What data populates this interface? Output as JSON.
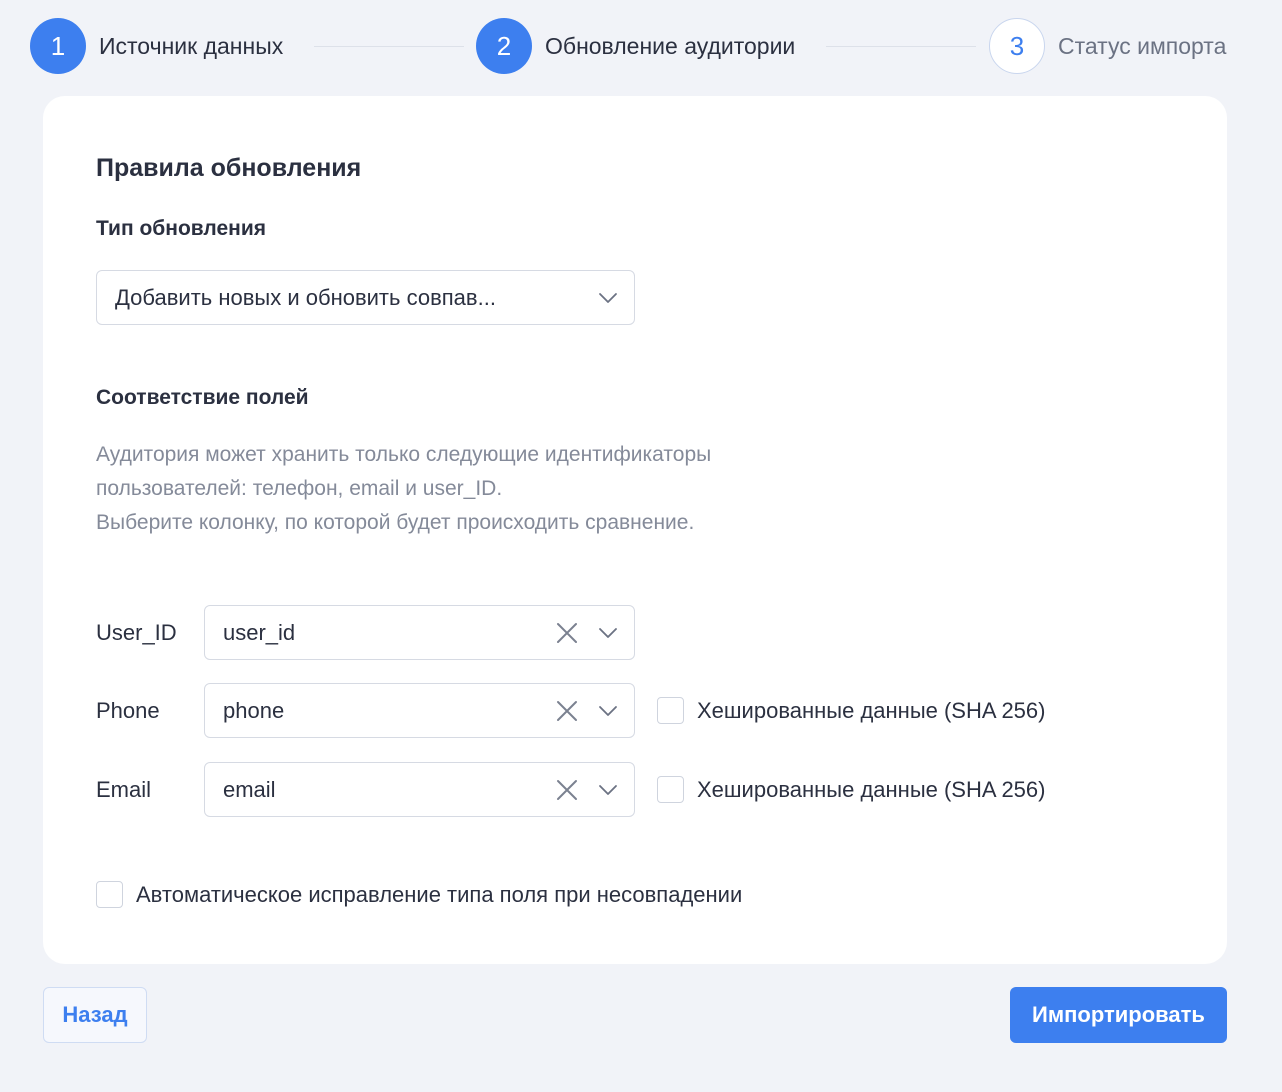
{
  "stepper": {
    "steps": [
      {
        "number": "1",
        "label": "Источник данных",
        "state": "active"
      },
      {
        "number": "2",
        "label": "Обновление аудитории",
        "state": "active"
      },
      {
        "number": "3",
        "label": "Статус импорта",
        "state": "inactive"
      }
    ]
  },
  "card": {
    "title": "Правила обновления",
    "update_type": {
      "label": "Тип обновления",
      "selected": "Добавить новых и обновить совпав..."
    },
    "mapping": {
      "title": "Соответствие полей",
      "description": [
        "Аудитория может хранить только следующие идентификаторы",
        "пользователей: телефон, email и user_ID.",
        "Выберите колонку, по которой будет происходить сравнение."
      ],
      "fields": [
        {
          "label": "User_ID",
          "value": "user_id",
          "hashed_label": null
        },
        {
          "label": "Phone",
          "value": "phone",
          "hashed_label": "Хешированные данные (SHA 256)",
          "hashed_checked": false
        },
        {
          "label": "Email",
          "value": "email",
          "hashed_label": "Хешированные данные (SHA 256)",
          "hashed_checked": false
        }
      ]
    },
    "auto_fix": {
      "label": "Автоматическое исправление типа поля при несовпадении",
      "checked": false
    }
  },
  "footer": {
    "back_label": "Назад",
    "import_label": "Импортировать"
  },
  "colors": {
    "accent": "#3d7fef",
    "background": "#f1f3f8"
  }
}
